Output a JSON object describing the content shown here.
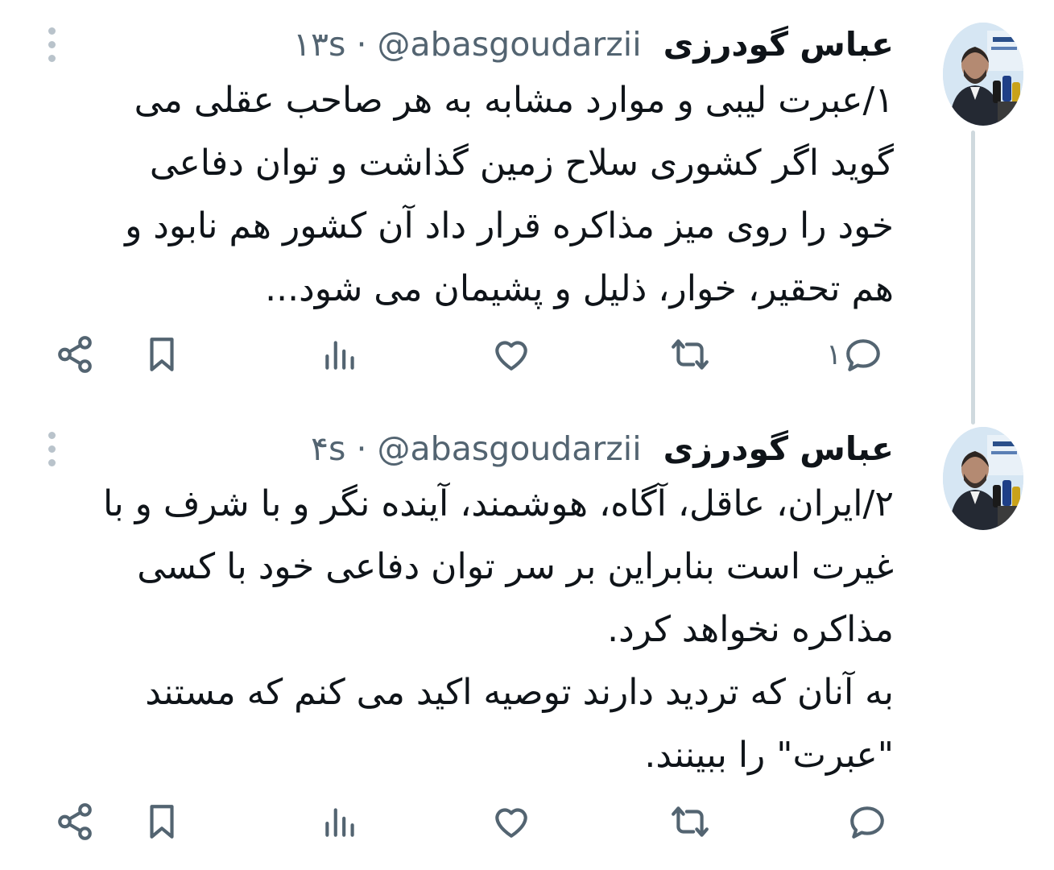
{
  "author": {
    "name": "عباس گودرزی",
    "handle": "@abasgoudarzii"
  },
  "tweets": [
    {
      "time": "۱۳s",
      "separator": "·",
      "lines": [
        "۱/عبرت لیبی و موارد مشابه به هر صاحب عقلی می",
        "گوید اگر کشوری سلاح زمین گذاشت و توان دفاعی",
        "خود را روی میز مذاکره قرار داد آن کشور هم نابود و",
        "هم تحقیر، خوار، ذلیل و پشیمان می شود..."
      ],
      "reply_count": "۱"
    },
    {
      "time": "۴s",
      "separator": "·",
      "lines": [
        "۲/ایران، عاقل، آگاه، هوشمند، آینده نگر و با شرف و با",
        "غیرت است بنابراین بر سر توان دفاعی خود با کسی",
        "مذاکره نخواهد کرد.",
        "به آنان که تردید دارند توصیه اکید می کنم که مستند",
        "\"عبرت\" را ببینند."
      ],
      "reply_count": ""
    }
  ],
  "icons": {
    "reply": "reply-icon",
    "retweet": "retweet-icon",
    "like": "like-icon",
    "views": "views-icon",
    "bookmark": "bookmark-icon",
    "share": "share-icon",
    "more": "more-options-icon"
  },
  "colors": {
    "text": "#0f1419",
    "secondary": "#536471",
    "thread_line": "#cfd9de",
    "background": "#ffffff"
  }
}
